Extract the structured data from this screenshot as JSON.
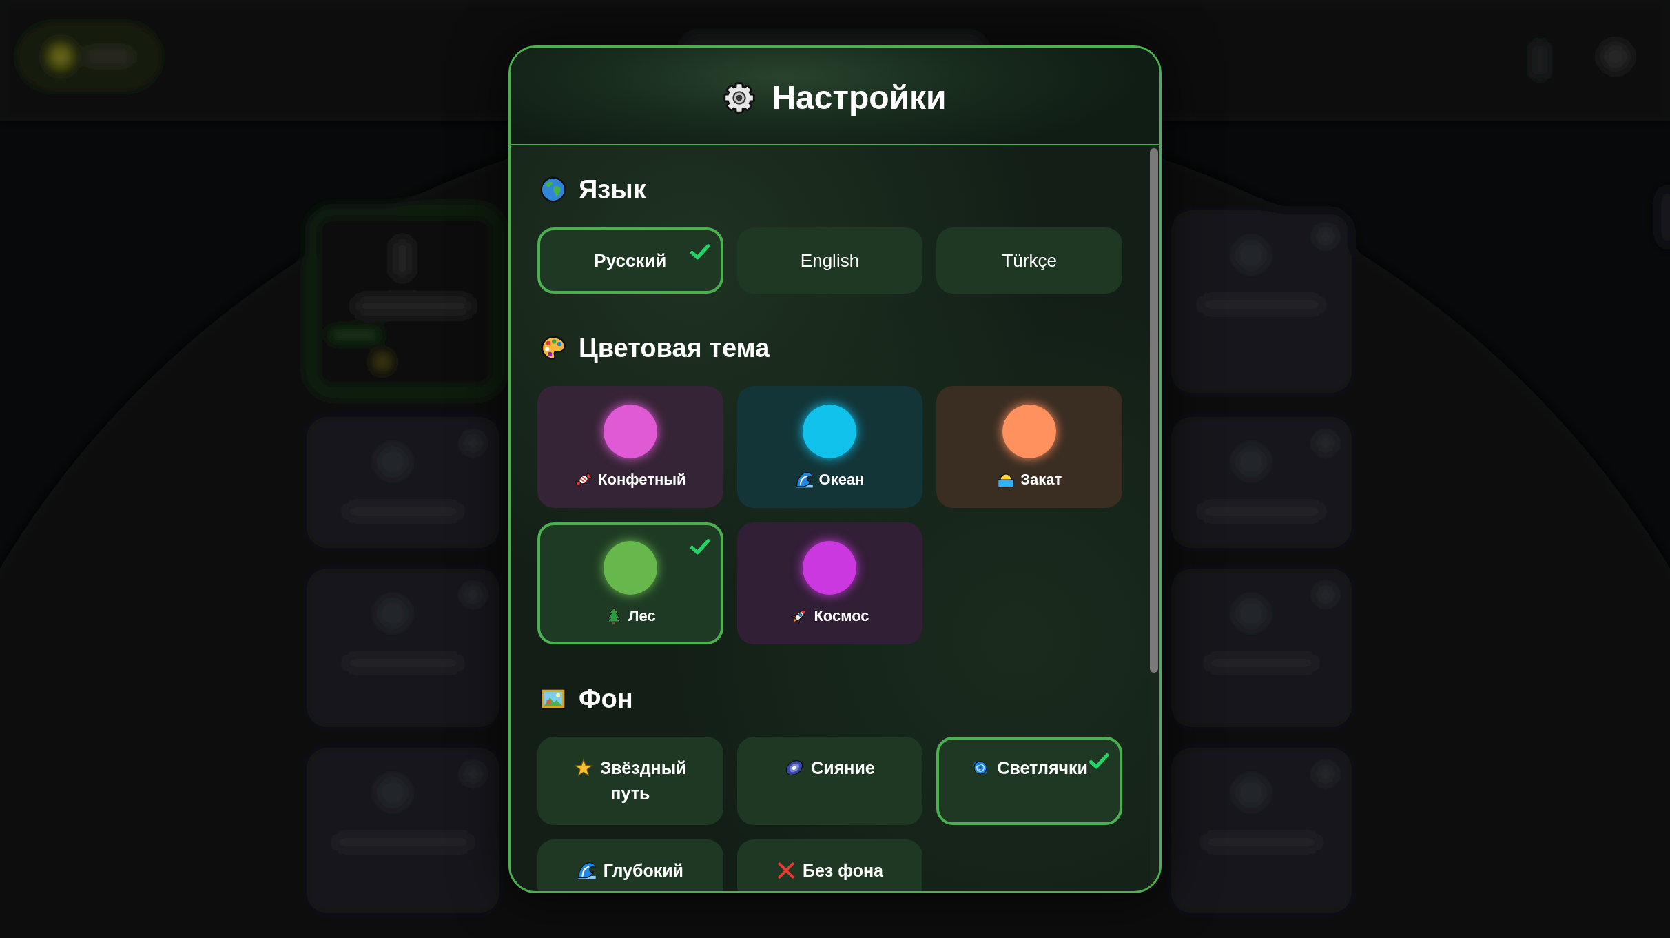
{
  "dialog": {
    "title": "Настройки"
  },
  "sections": [
    {
      "kind": "language",
      "title": "Язык",
      "options": [
        {
          "label": "Русский",
          "selected": true
        },
        {
          "label": "English",
          "selected": false
        },
        {
          "label": "Türkçe",
          "selected": false
        }
      ]
    },
    {
      "kind": "theme",
      "title": "Цветовая тема",
      "options": [
        {
          "label": "Конфетный",
          "color": "#e05ad6",
          "selected": false
        },
        {
          "label": "Океан",
          "color": "#10c2ec",
          "selected": false
        },
        {
          "label": "Закат",
          "color": "#ff915e",
          "selected": false
        },
        {
          "label": "Лес",
          "color": "#66b84c",
          "selected": true
        },
        {
          "label": "Космос",
          "color": "#cc38e0",
          "selected": false
        }
      ]
    },
    {
      "kind": "background",
      "title": "Фон",
      "options": [
        {
          "label": "Звёздный путь",
          "selected": false
        },
        {
          "label": "Сияние",
          "selected": false
        },
        {
          "label": "Светлячки",
          "selected": true
        },
        {
          "label": "Глубокий",
          "selected": false
        },
        {
          "label": "Без фона",
          "selected": false
        }
      ]
    }
  ]
}
